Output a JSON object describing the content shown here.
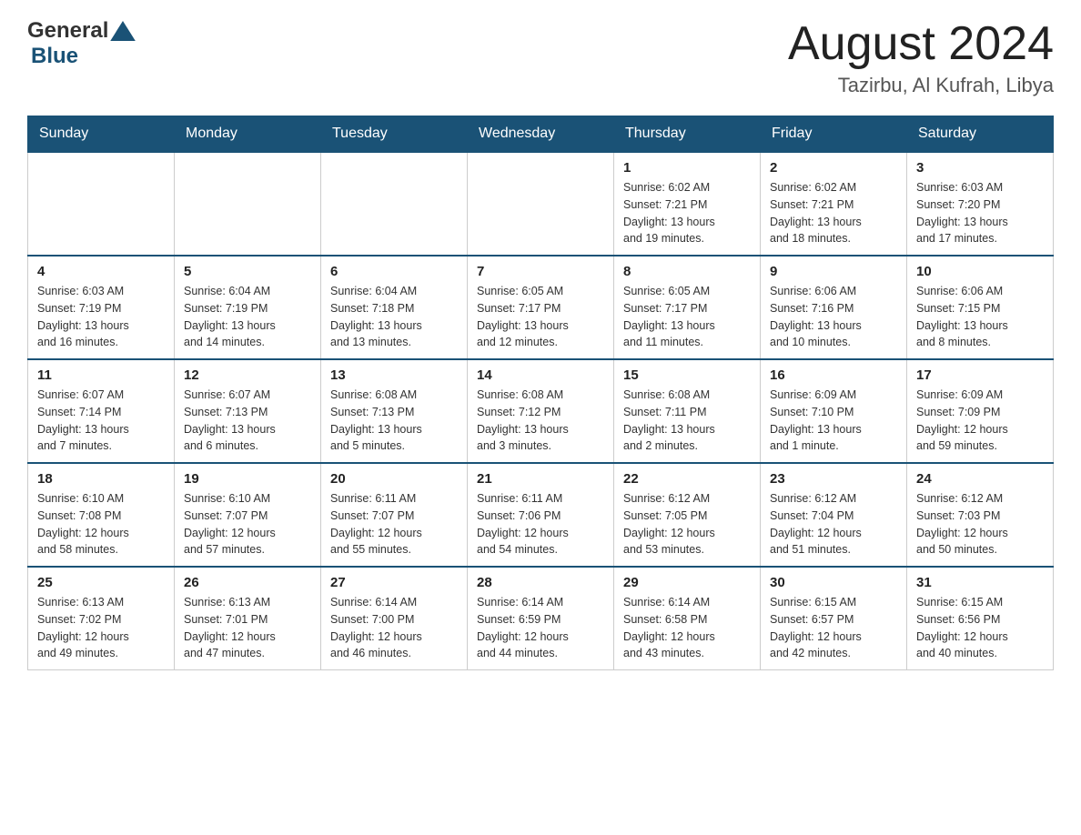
{
  "header": {
    "logo_general": "General",
    "logo_blue": "Blue",
    "month_title": "August 2024",
    "location": "Tazirbu, Al Kufrah, Libya"
  },
  "weekdays": [
    "Sunday",
    "Monday",
    "Tuesday",
    "Wednesday",
    "Thursday",
    "Friday",
    "Saturday"
  ],
  "weeks": [
    [
      {
        "day": "",
        "info": ""
      },
      {
        "day": "",
        "info": ""
      },
      {
        "day": "",
        "info": ""
      },
      {
        "day": "",
        "info": ""
      },
      {
        "day": "1",
        "info": "Sunrise: 6:02 AM\nSunset: 7:21 PM\nDaylight: 13 hours\nand 19 minutes."
      },
      {
        "day": "2",
        "info": "Sunrise: 6:02 AM\nSunset: 7:21 PM\nDaylight: 13 hours\nand 18 minutes."
      },
      {
        "day": "3",
        "info": "Sunrise: 6:03 AM\nSunset: 7:20 PM\nDaylight: 13 hours\nand 17 minutes."
      }
    ],
    [
      {
        "day": "4",
        "info": "Sunrise: 6:03 AM\nSunset: 7:19 PM\nDaylight: 13 hours\nand 16 minutes."
      },
      {
        "day": "5",
        "info": "Sunrise: 6:04 AM\nSunset: 7:19 PM\nDaylight: 13 hours\nand 14 minutes."
      },
      {
        "day": "6",
        "info": "Sunrise: 6:04 AM\nSunset: 7:18 PM\nDaylight: 13 hours\nand 13 minutes."
      },
      {
        "day": "7",
        "info": "Sunrise: 6:05 AM\nSunset: 7:17 PM\nDaylight: 13 hours\nand 12 minutes."
      },
      {
        "day": "8",
        "info": "Sunrise: 6:05 AM\nSunset: 7:17 PM\nDaylight: 13 hours\nand 11 minutes."
      },
      {
        "day": "9",
        "info": "Sunrise: 6:06 AM\nSunset: 7:16 PM\nDaylight: 13 hours\nand 10 minutes."
      },
      {
        "day": "10",
        "info": "Sunrise: 6:06 AM\nSunset: 7:15 PM\nDaylight: 13 hours\nand 8 minutes."
      }
    ],
    [
      {
        "day": "11",
        "info": "Sunrise: 6:07 AM\nSunset: 7:14 PM\nDaylight: 13 hours\nand 7 minutes."
      },
      {
        "day": "12",
        "info": "Sunrise: 6:07 AM\nSunset: 7:13 PM\nDaylight: 13 hours\nand 6 minutes."
      },
      {
        "day": "13",
        "info": "Sunrise: 6:08 AM\nSunset: 7:13 PM\nDaylight: 13 hours\nand 5 minutes."
      },
      {
        "day": "14",
        "info": "Sunrise: 6:08 AM\nSunset: 7:12 PM\nDaylight: 13 hours\nand 3 minutes."
      },
      {
        "day": "15",
        "info": "Sunrise: 6:08 AM\nSunset: 7:11 PM\nDaylight: 13 hours\nand 2 minutes."
      },
      {
        "day": "16",
        "info": "Sunrise: 6:09 AM\nSunset: 7:10 PM\nDaylight: 13 hours\nand 1 minute."
      },
      {
        "day": "17",
        "info": "Sunrise: 6:09 AM\nSunset: 7:09 PM\nDaylight: 12 hours\nand 59 minutes."
      }
    ],
    [
      {
        "day": "18",
        "info": "Sunrise: 6:10 AM\nSunset: 7:08 PM\nDaylight: 12 hours\nand 58 minutes."
      },
      {
        "day": "19",
        "info": "Sunrise: 6:10 AM\nSunset: 7:07 PM\nDaylight: 12 hours\nand 57 minutes."
      },
      {
        "day": "20",
        "info": "Sunrise: 6:11 AM\nSunset: 7:07 PM\nDaylight: 12 hours\nand 55 minutes."
      },
      {
        "day": "21",
        "info": "Sunrise: 6:11 AM\nSunset: 7:06 PM\nDaylight: 12 hours\nand 54 minutes."
      },
      {
        "day": "22",
        "info": "Sunrise: 6:12 AM\nSunset: 7:05 PM\nDaylight: 12 hours\nand 53 minutes."
      },
      {
        "day": "23",
        "info": "Sunrise: 6:12 AM\nSunset: 7:04 PM\nDaylight: 12 hours\nand 51 minutes."
      },
      {
        "day": "24",
        "info": "Sunrise: 6:12 AM\nSunset: 7:03 PM\nDaylight: 12 hours\nand 50 minutes."
      }
    ],
    [
      {
        "day": "25",
        "info": "Sunrise: 6:13 AM\nSunset: 7:02 PM\nDaylight: 12 hours\nand 49 minutes."
      },
      {
        "day": "26",
        "info": "Sunrise: 6:13 AM\nSunset: 7:01 PM\nDaylight: 12 hours\nand 47 minutes."
      },
      {
        "day": "27",
        "info": "Sunrise: 6:14 AM\nSunset: 7:00 PM\nDaylight: 12 hours\nand 46 minutes."
      },
      {
        "day": "28",
        "info": "Sunrise: 6:14 AM\nSunset: 6:59 PM\nDaylight: 12 hours\nand 44 minutes."
      },
      {
        "day": "29",
        "info": "Sunrise: 6:14 AM\nSunset: 6:58 PM\nDaylight: 12 hours\nand 43 minutes."
      },
      {
        "day": "30",
        "info": "Sunrise: 6:15 AM\nSunset: 6:57 PM\nDaylight: 12 hours\nand 42 minutes."
      },
      {
        "day": "31",
        "info": "Sunrise: 6:15 AM\nSunset: 6:56 PM\nDaylight: 12 hours\nand 40 minutes."
      }
    ]
  ]
}
